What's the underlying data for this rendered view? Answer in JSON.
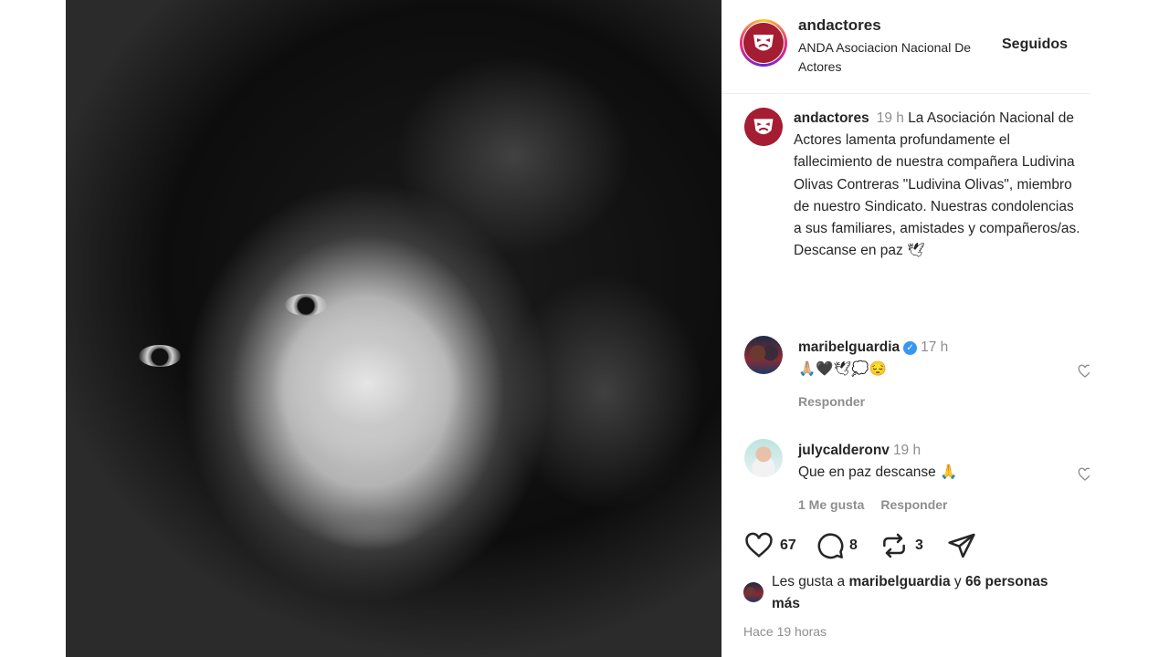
{
  "header": {
    "username": "andactores",
    "subtitle": "ANDA Asociacion Nacional De Actores",
    "follow_label": "Seguidos"
  },
  "caption": {
    "username": "andactores",
    "time": "19 h",
    "text": "La Asociación Nacional de Actores lamenta profundamente el fallecimiento de nuestra compañera Ludivina Olivas Contreras \"Ludivina Olivas\", miembro de nuestro Sindicato. Nuestras condolencias a sus familiares, amistades y compañeros/as. Descanse en paz 🕊"
  },
  "comments": [
    {
      "username": "maribelguardia",
      "verified": true,
      "time": "17 h",
      "text": "🙏🏼🖤🕊💭😔",
      "actions": [
        "Responder"
      ]
    },
    {
      "username": "julycalderonv",
      "verified": false,
      "time": "19 h",
      "text": "Que en paz descanse 🙏",
      "actions": [
        "1 Me gusta",
        "Responder"
      ]
    }
  ],
  "actions": {
    "likes_count": "67",
    "comments_count": "8",
    "reposts_count": "3"
  },
  "likes_summary": {
    "prefix": "Les gusta a",
    "user": "maribelguardia",
    "conjunction": "y",
    "others": "66 personas",
    "suffix": "más"
  },
  "timestamp": "Hace 19 horas",
  "colors": {
    "brand": "#a51d32",
    "verified": "#3897f0",
    "muted": "#8e8e8e"
  },
  "icons": [
    "heart-icon",
    "comment-icon",
    "repost-icon",
    "share-icon",
    "verified-badge-icon"
  ]
}
